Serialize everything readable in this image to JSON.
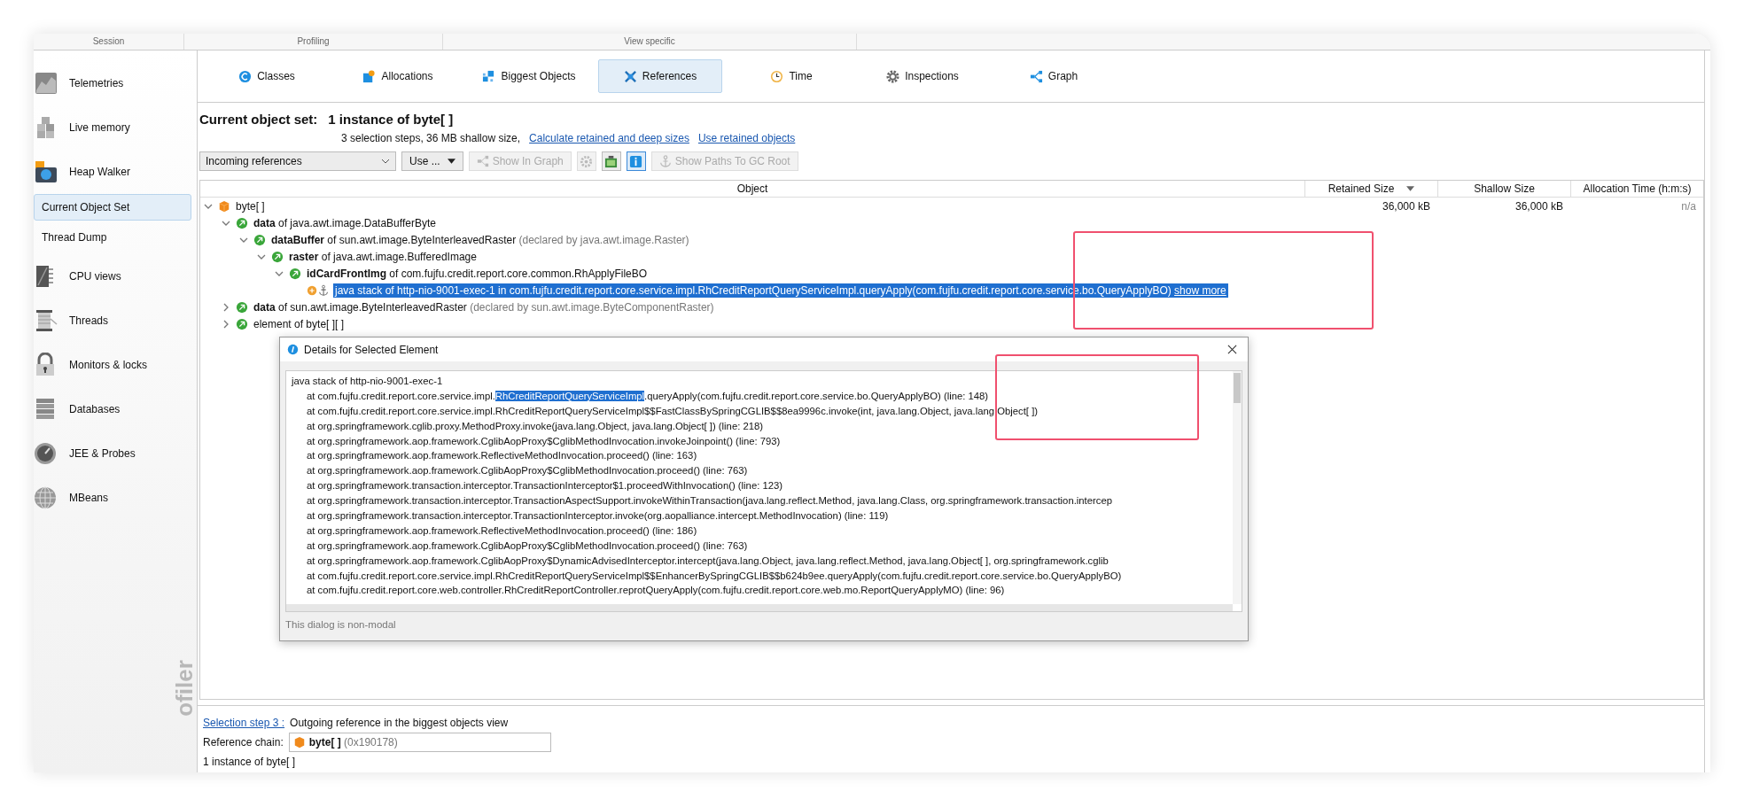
{
  "sections": [
    "Session",
    "Profiling",
    "View specific"
  ],
  "sidebar": {
    "items": [
      {
        "kind": "view",
        "label": "Telemetries",
        "selected": false
      },
      {
        "kind": "view",
        "label": "Live memory",
        "selected": false
      },
      {
        "kind": "view",
        "label": "Heap Walker",
        "selected": false
      },
      {
        "kind": "subview",
        "label": "Current Object Set",
        "selected": true
      },
      {
        "kind": "subview",
        "label": "Thread Dump",
        "selected": false
      },
      {
        "kind": "view",
        "label": "CPU views",
        "selected": false
      },
      {
        "kind": "view",
        "label": "Threads",
        "selected": false
      },
      {
        "kind": "view",
        "label": "Monitors & locks",
        "selected": false
      },
      {
        "kind": "view",
        "label": "Databases",
        "selected": false
      },
      {
        "kind": "view",
        "label": "JEE & Probes",
        "selected": false
      },
      {
        "kind": "view",
        "label": "MBeans",
        "selected": false
      }
    ],
    "logo_text": "ofiler"
  },
  "tabs": [
    {
      "label": "Classes",
      "selected": false
    },
    {
      "label": "Allocations",
      "selected": false
    },
    {
      "label": "Biggest Objects",
      "selected": false
    },
    {
      "label": "References",
      "selected": true
    },
    {
      "label": "Time",
      "selected": false
    },
    {
      "label": "Inspections",
      "selected": false
    },
    {
      "label": "Graph",
      "selected": false
    }
  ],
  "object_set": {
    "label": "Current object set:",
    "value": "1 instance of byte[ ]",
    "summary": "3 selection steps, 36 MB shallow size,",
    "links": [
      "Calculate retained and deep sizes",
      "Use retained objects"
    ]
  },
  "toolbar": {
    "dropdown": "Incoming references",
    "use_button": "Use ...",
    "buttons": [
      {
        "kind": "text",
        "label": "Show In Graph",
        "disabled": true,
        "pressed": false
      },
      {
        "kind": "icon",
        "disabled": true,
        "pressed": false
      },
      {
        "kind": "icon",
        "disabled": false,
        "pressed": false
      },
      {
        "kind": "icon",
        "disabled": false,
        "pressed": true
      },
      {
        "kind": "text",
        "label": "Show Paths To GC Root",
        "disabled": true,
        "pressed": false
      }
    ]
  },
  "table": {
    "columns": [
      {
        "label": "Object",
        "sorted": false
      },
      {
        "label": "Retained Size",
        "sorted": true
      },
      {
        "label": "Shallow Size",
        "sorted": false
      },
      {
        "label": "Allocation Time (h:m:s)",
        "sorted": false
      }
    ],
    "tree": [
      {
        "kind": "object",
        "text": "byte[ ]",
        "retained": "36,000 kB",
        "shallow": "36,000 kB",
        "alloc": "n/a",
        "expanded": true,
        "selected": false,
        "children": [
          {
            "kind": "field",
            "name": "data",
            "text": "of java.awt.image.DataBufferByte",
            "expanded": true,
            "selected": false,
            "children": [
              {
                "kind": "field",
                "name": "dataBuffer",
                "text": "of sun.awt.image.ByteInterleavedRaster",
                "declared": "(declared by java.awt.image.Raster)",
                "expanded": true,
                "selected": false,
                "children": [
                  {
                    "kind": "field",
                    "name": "raster",
                    "text": "of java.awt.image.BufferedImage",
                    "expanded": true,
                    "selected": false,
                    "children": [
                      {
                        "kind": "field",
                        "name": "idCardFrontImg",
                        "text": "of com.fujfu.credit.report.core.common.RhApplyFileBO",
                        "expanded": true,
                        "selected": false,
                        "children": [
                          {
                            "kind": "stack",
                            "text": "java stack of http-nio-9001-exec-1 in com.fujfu.credit.report.core.service.impl.RhCreditReportQueryServiceImpl.queryApply(com.fujfu.credit.report.core.service.bo.QueryApplyBO)",
                            "link": "show more",
                            "selected": true
                          }
                        ]
                      }
                    ]
                  }
                ]
              }
            ]
          },
          {
            "kind": "field",
            "name": "data",
            "text": "of sun.awt.image.ByteInterleavedRaster",
            "declared": "(declared by sun.awt.image.ByteComponentRaster)",
            "expanded": false,
            "selected": false
          },
          {
            "kind": "element",
            "text": "element of byte[ ][ ]",
            "expanded": false,
            "selected": false
          }
        ]
      }
    ]
  },
  "dialog": {
    "title": "Details for Selected Element",
    "lines": [
      {
        "kind": "header",
        "text": "java stack of http-nio-9001-exec-1"
      },
      {
        "kind": "frame_selected",
        "before": "at com.fujfu.credit.report.core.service.impl.",
        "selected": "RhCreditReportQueryServiceImpl",
        "after": ".queryApply(com.fujfu.credit.report.core.service.bo.QueryApplyBO) (line: 148)"
      },
      {
        "kind": "frame",
        "text": "at com.fujfu.credit.report.core.service.impl.RhCreditReportQueryServiceImpl$$FastClassBySpringCGLIB$$8ea9996c.invoke(int, java.lang.Object, java.lang.Object[ ])"
      },
      {
        "kind": "frame",
        "text": "at org.springframework.cglib.proxy.MethodProxy.invoke(java.lang.Object, java.lang.Object[ ]) (line: 218)"
      },
      {
        "kind": "frame",
        "text": "at org.springframework.aop.framework.CglibAopProxy$CglibMethodInvocation.invokeJoinpoint() (line: 793)"
      },
      {
        "kind": "frame",
        "text": "at org.springframework.aop.framework.ReflectiveMethodInvocation.proceed() (line: 163)"
      },
      {
        "kind": "frame",
        "text": "at org.springframework.aop.framework.CglibAopProxy$CglibMethodInvocation.proceed() (line: 763)"
      },
      {
        "kind": "frame",
        "text": "at org.springframework.transaction.interceptor.TransactionInterceptor$1.proceedWithInvocation() (line: 123)"
      },
      {
        "kind": "frame",
        "text": "at org.springframework.transaction.interceptor.TransactionAspectSupport.invokeWithinTransaction(java.lang.reflect.Method, java.lang.Class, org.springframework.transaction.intercep"
      },
      {
        "kind": "frame",
        "text": "at org.springframework.transaction.interceptor.TransactionInterceptor.invoke(org.aopalliance.intercept.MethodInvocation) (line: 119)"
      },
      {
        "kind": "frame",
        "text": "at org.springframework.aop.framework.ReflectiveMethodInvocation.proceed() (line: 186)"
      },
      {
        "kind": "frame",
        "text": "at org.springframework.aop.framework.CglibAopProxy$CglibMethodInvocation.proceed() (line: 763)"
      },
      {
        "kind": "frame",
        "text": "at org.springframework.aop.framework.CglibAopProxy$DynamicAdvisedInterceptor.intercept(java.lang.Object, java.lang.reflect.Method, java.lang.Object[ ], org.springframework.cglib"
      },
      {
        "kind": "frame",
        "text": "at com.fujfu.credit.report.core.service.impl.RhCreditReportQueryServiceImpl$$EnhancerBySpringCGLIB$$b624b9ee.queryApply(com.fujfu.credit.report.core.service.bo.QueryApplyBO)"
      },
      {
        "kind": "frame",
        "text": "at com.fujfu.credit.report.core.web.controller.RhCreditReportController.reprotQueryApply(com.fujfu.credit.report.core.web.mo.ReportQueryApplyMO) (line: 96)"
      }
    ],
    "footer": "This dialog is non-modal"
  },
  "selection_panel": {
    "step_link": "Selection step 3 :",
    "step_text": "Outgoing reference in the biggest objects view",
    "chain_label": "Reference chain:",
    "chain_name": "byte[ ]",
    "chain_address": "(0x190178)",
    "count_text": "1 instance of byte[ ]"
  }
}
